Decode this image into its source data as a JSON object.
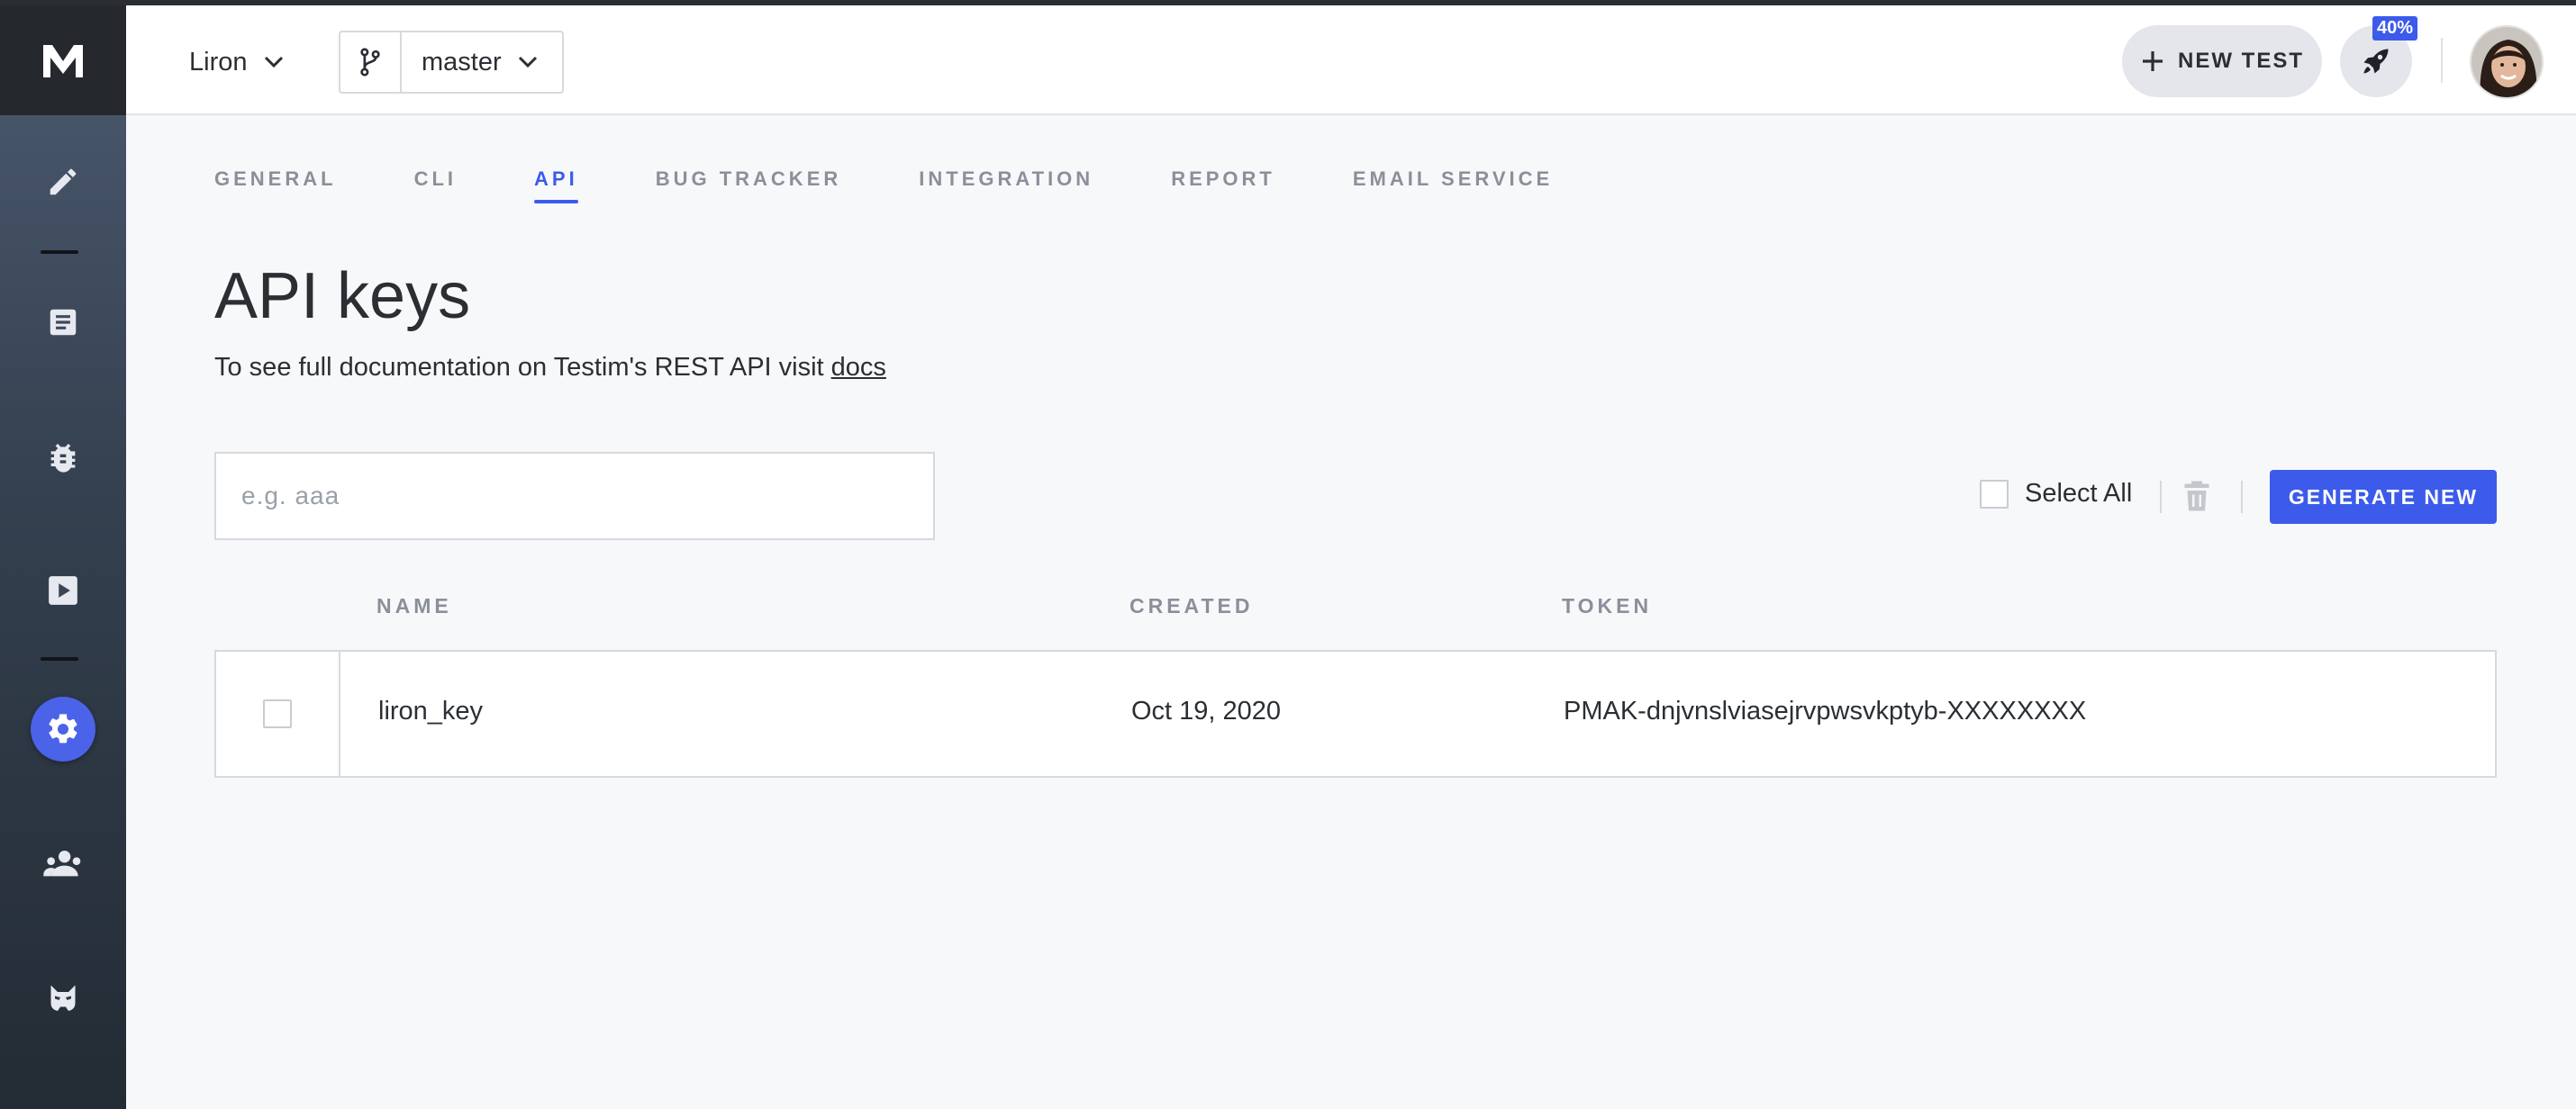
{
  "header": {
    "project": "Liron",
    "branch": "master",
    "new_test_label": "NEW TEST",
    "usage_badge": "40%"
  },
  "tabs": [
    {
      "label": "GENERAL"
    },
    {
      "label": "CLI"
    },
    {
      "label": "API",
      "active": true
    },
    {
      "label": "BUG TRACKER"
    },
    {
      "label": "INTEGRATION"
    },
    {
      "label": "REPORT"
    },
    {
      "label": "EMAIL SERVICE"
    }
  ],
  "page": {
    "title": "API keys",
    "doc_text": "To see full documentation on Testim's REST API visit ",
    "doc_link": "docs"
  },
  "search": {
    "placeholder": "e.g. aaa",
    "value": ""
  },
  "toolbar": {
    "select_all_label": "Select All",
    "generate_label": "GENERATE NEW"
  },
  "table": {
    "columns": [
      "NAME",
      "CREATED",
      "TOKEN"
    ],
    "rows": [
      {
        "name": "liron_key",
        "created": "Oct 19, 2020",
        "token": "PMAK-dnjvnslviasejrvpwsvkptyb-XXXXXXXX"
      }
    ]
  },
  "sidebar": {
    "items": [
      {
        "icon": "pencil-icon"
      },
      {
        "icon": "document-icon"
      },
      {
        "icon": "bug-icon"
      },
      {
        "icon": "play-icon"
      },
      {
        "icon": "gear-icon",
        "active": true
      },
      {
        "icon": "users-icon"
      },
      {
        "icon": "mask-icon"
      }
    ]
  },
  "colors": {
    "accent": "#3c5bea",
    "sidebar_top": "#4c5a70",
    "sidebar_bottom": "#232b34",
    "background": "#f7f8fa"
  }
}
